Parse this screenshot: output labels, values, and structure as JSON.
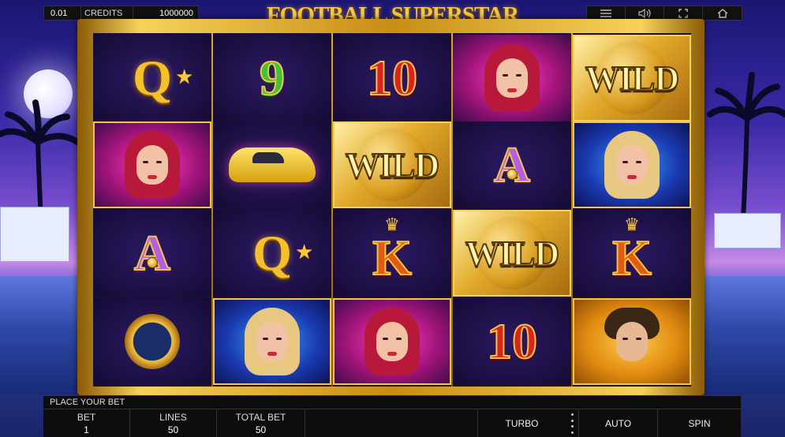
{
  "game_title": "FOOTBALL SUPERSTAR",
  "top_bar": {
    "stake": "0.01",
    "credits_label": "CREDITS",
    "credits_value": "1000000",
    "icons": [
      "menu-icon",
      "volume-icon",
      "fullscreen-icon",
      "home-icon"
    ]
  },
  "reels": [
    [
      "Q",
      "woman-redhead",
      "A",
      "watch"
    ],
    [
      "9",
      "car",
      "Q",
      "woman-blonde"
    ],
    [
      "10",
      "WILD",
      "K",
      "woman-redhead"
    ],
    [
      "woman-redhead",
      "A",
      "WILD",
      "10"
    ],
    [
      "WILD",
      "woman-blonde",
      "K",
      "footballer"
    ]
  ],
  "wild_label": "WILD",
  "bottom_bar": {
    "message": "PLACE YOUR BET",
    "bet_label": "BET",
    "bet_value": "1",
    "lines_label": "LINES",
    "lines_value": "50",
    "total_bet_label": "TOTAL BET",
    "total_bet_value": "50",
    "turbo_label": "TURBO",
    "auto_label": "AUTO",
    "spin_label": "SPIN"
  },
  "colors": {
    "gold": "#f3c445",
    "frame_dark": "#8a5a05",
    "bar_bg": "#0d0d10"
  }
}
